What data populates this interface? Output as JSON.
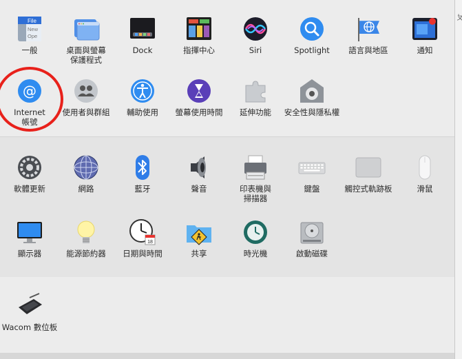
{
  "sections": [
    {
      "items": [
        {
          "label": "一般",
          "icon": "general-icon"
        },
        {
          "label": "桌面與螢幕\n保護程式",
          "icon": "desktop-screensaver-icon"
        },
        {
          "label": "Dock",
          "icon": "dock-icon"
        },
        {
          "label": "指揮中心",
          "icon": "mission-control-icon"
        },
        {
          "label": "Siri",
          "icon": "siri-icon"
        },
        {
          "label": "Spotlight",
          "icon": "spotlight-icon"
        },
        {
          "label": "語言與地區",
          "icon": "language-region-icon"
        },
        {
          "label": "通知",
          "icon": "notifications-icon"
        },
        {
          "label": "Internet\n帳號",
          "icon": "internet-accounts-icon"
        },
        {
          "label": "使用者與群組",
          "icon": "users-groups-icon"
        },
        {
          "label": "輔助使用",
          "icon": "accessibility-icon"
        },
        {
          "label": "螢幕使用時間",
          "icon": "screen-time-icon"
        },
        {
          "label": "延伸功能",
          "icon": "extensions-icon"
        },
        {
          "label": "安全性與隱私權",
          "icon": "security-privacy-icon"
        }
      ]
    },
    {
      "items": [
        {
          "label": "軟體更新",
          "icon": "software-update-icon"
        },
        {
          "label": "網路",
          "icon": "network-icon"
        },
        {
          "label": "藍牙",
          "icon": "bluetooth-icon"
        },
        {
          "label": "聲音",
          "icon": "sound-icon"
        },
        {
          "label": "印表機與\n掃描器",
          "icon": "printers-scanners-icon"
        },
        {
          "label": "鍵盤",
          "icon": "keyboard-icon"
        },
        {
          "label": "觸控式軌跡板",
          "icon": "trackpad-icon"
        },
        {
          "label": "滑鼠",
          "icon": "mouse-icon"
        },
        {
          "label": "顯示器",
          "icon": "displays-icon"
        },
        {
          "label": "能源節約器",
          "icon": "energy-saver-icon"
        },
        {
          "label": "日期與時間",
          "icon": "date-time-icon"
        },
        {
          "label": "共享",
          "icon": "sharing-icon"
        },
        {
          "label": "時光機",
          "icon": "time-machine-icon"
        },
        {
          "label": "啟動磁碟",
          "icon": "startup-disk-icon"
        }
      ]
    },
    {
      "items": [
        {
          "label": "Wacom 數位板",
          "icon": "wacom-tablet-icon"
        }
      ]
    }
  ],
  "highlight_color": "#e8211b",
  "calendar_day": "18",
  "general_icon_text": [
    "File",
    "New",
    "Ope"
  ],
  "edge_glyph": "ㄆ"
}
